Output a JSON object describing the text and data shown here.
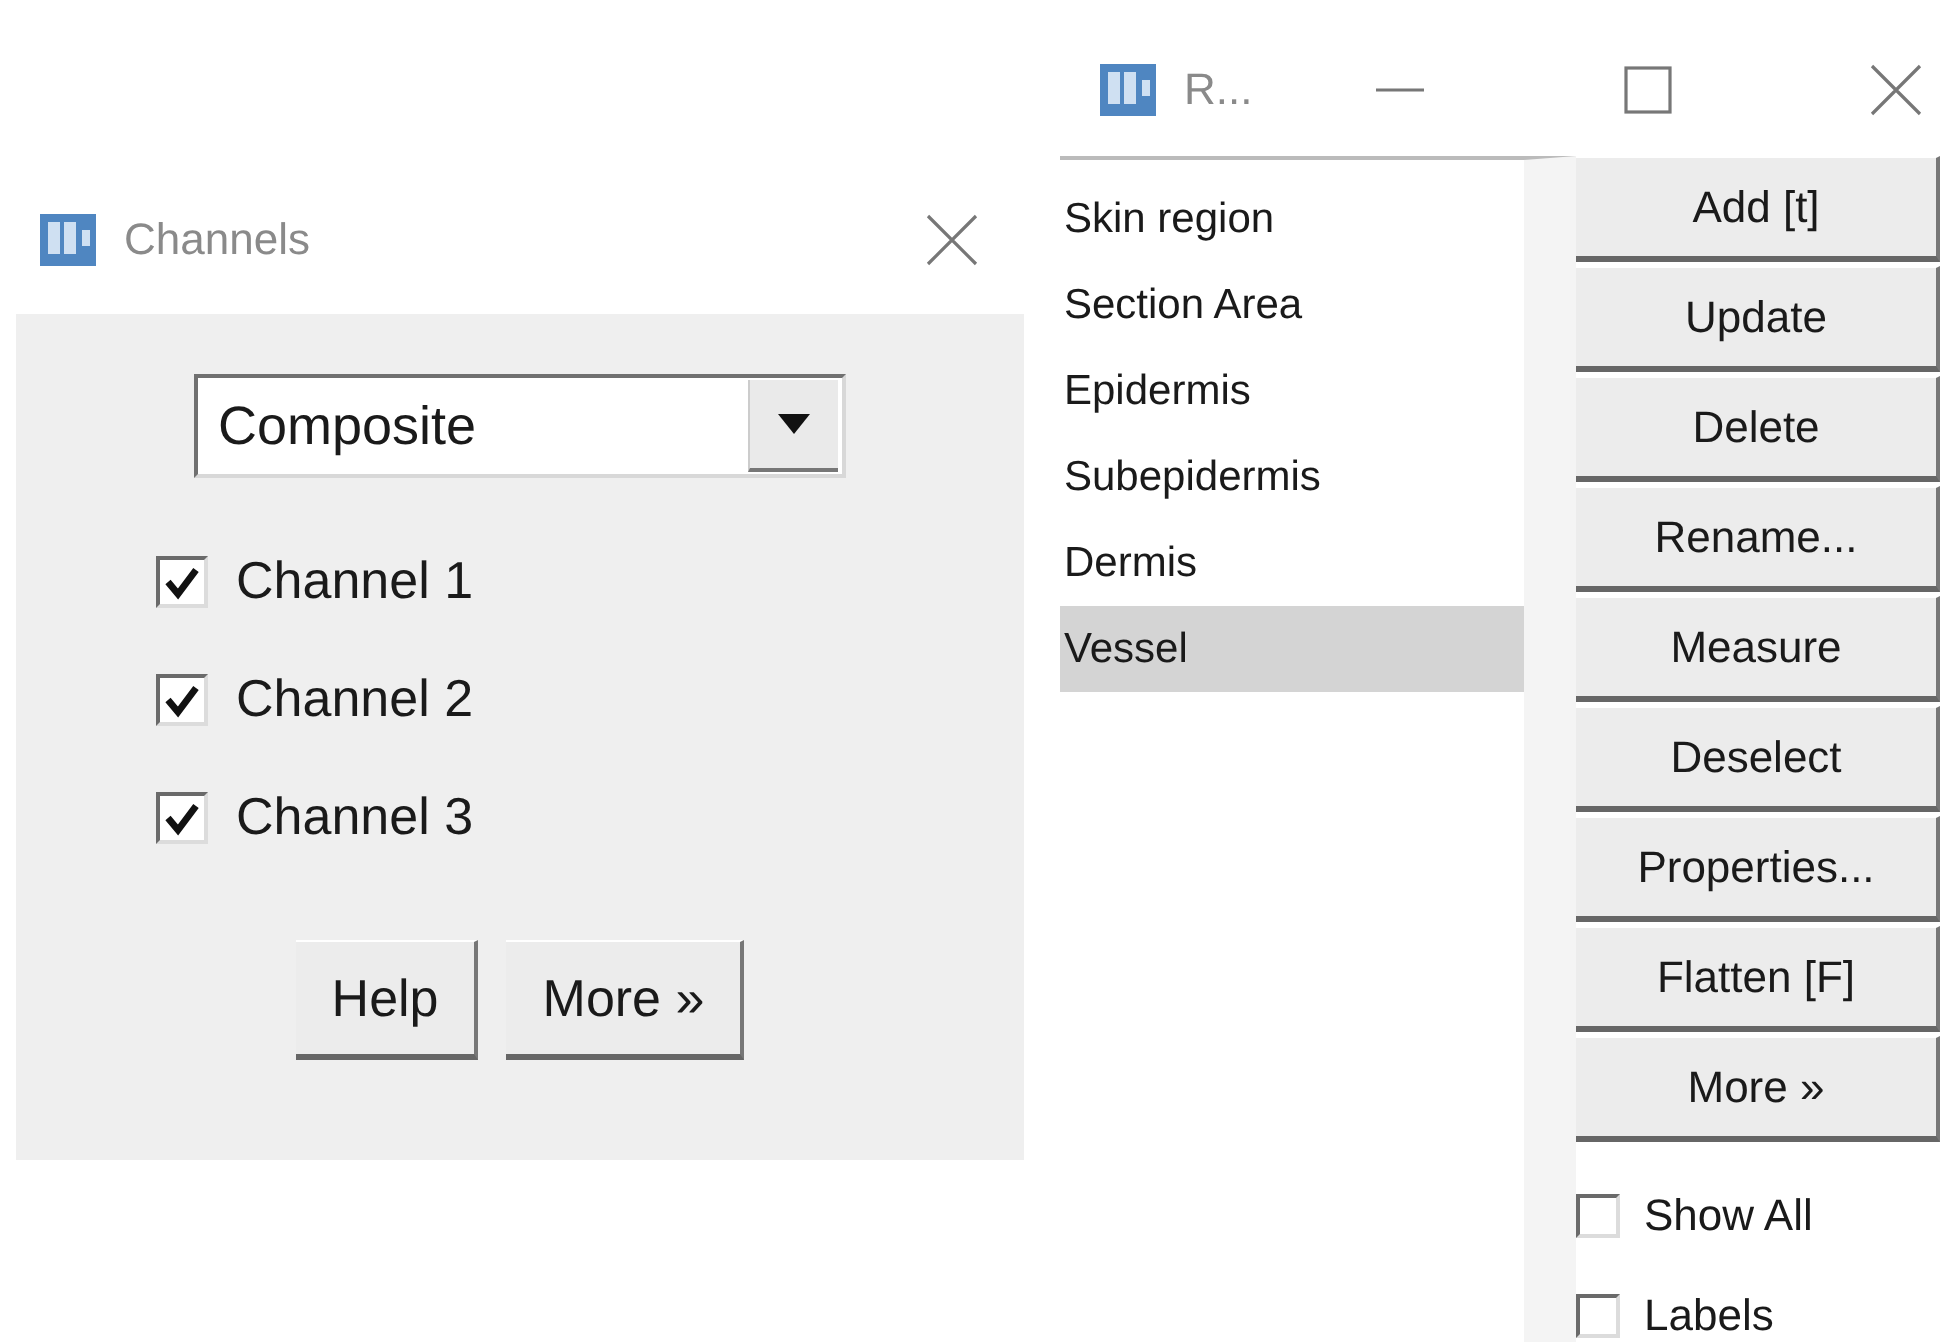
{
  "channels_window": {
    "title": "Channels",
    "mode_dropdown": {
      "value": "Composite"
    },
    "channels": [
      {
        "label": "Channel 1",
        "checked": true
      },
      {
        "label": "Channel 2",
        "checked": true
      },
      {
        "label": "Channel 3",
        "checked": true
      }
    ],
    "buttons": [
      "Help",
      "More »"
    ]
  },
  "roi_window": {
    "title": "R...",
    "rois": [
      {
        "label": "Skin region",
        "selected": false
      },
      {
        "label": "Section Area",
        "selected": false
      },
      {
        "label": "Epidermis",
        "selected": false
      },
      {
        "label": "Subepidermis",
        "selected": false
      },
      {
        "label": "Dermis",
        "selected": false
      },
      {
        "label": "Vessel",
        "selected": true
      }
    ],
    "buttons": [
      "Add [t]",
      "Update",
      "Delete",
      "Rename...",
      "Measure",
      "Deselect",
      "Properties...",
      "Flatten [F]",
      "More »"
    ],
    "options": [
      {
        "label": "Show All",
        "checked": false
      },
      {
        "label": "Labels",
        "checked": false
      }
    ]
  }
}
